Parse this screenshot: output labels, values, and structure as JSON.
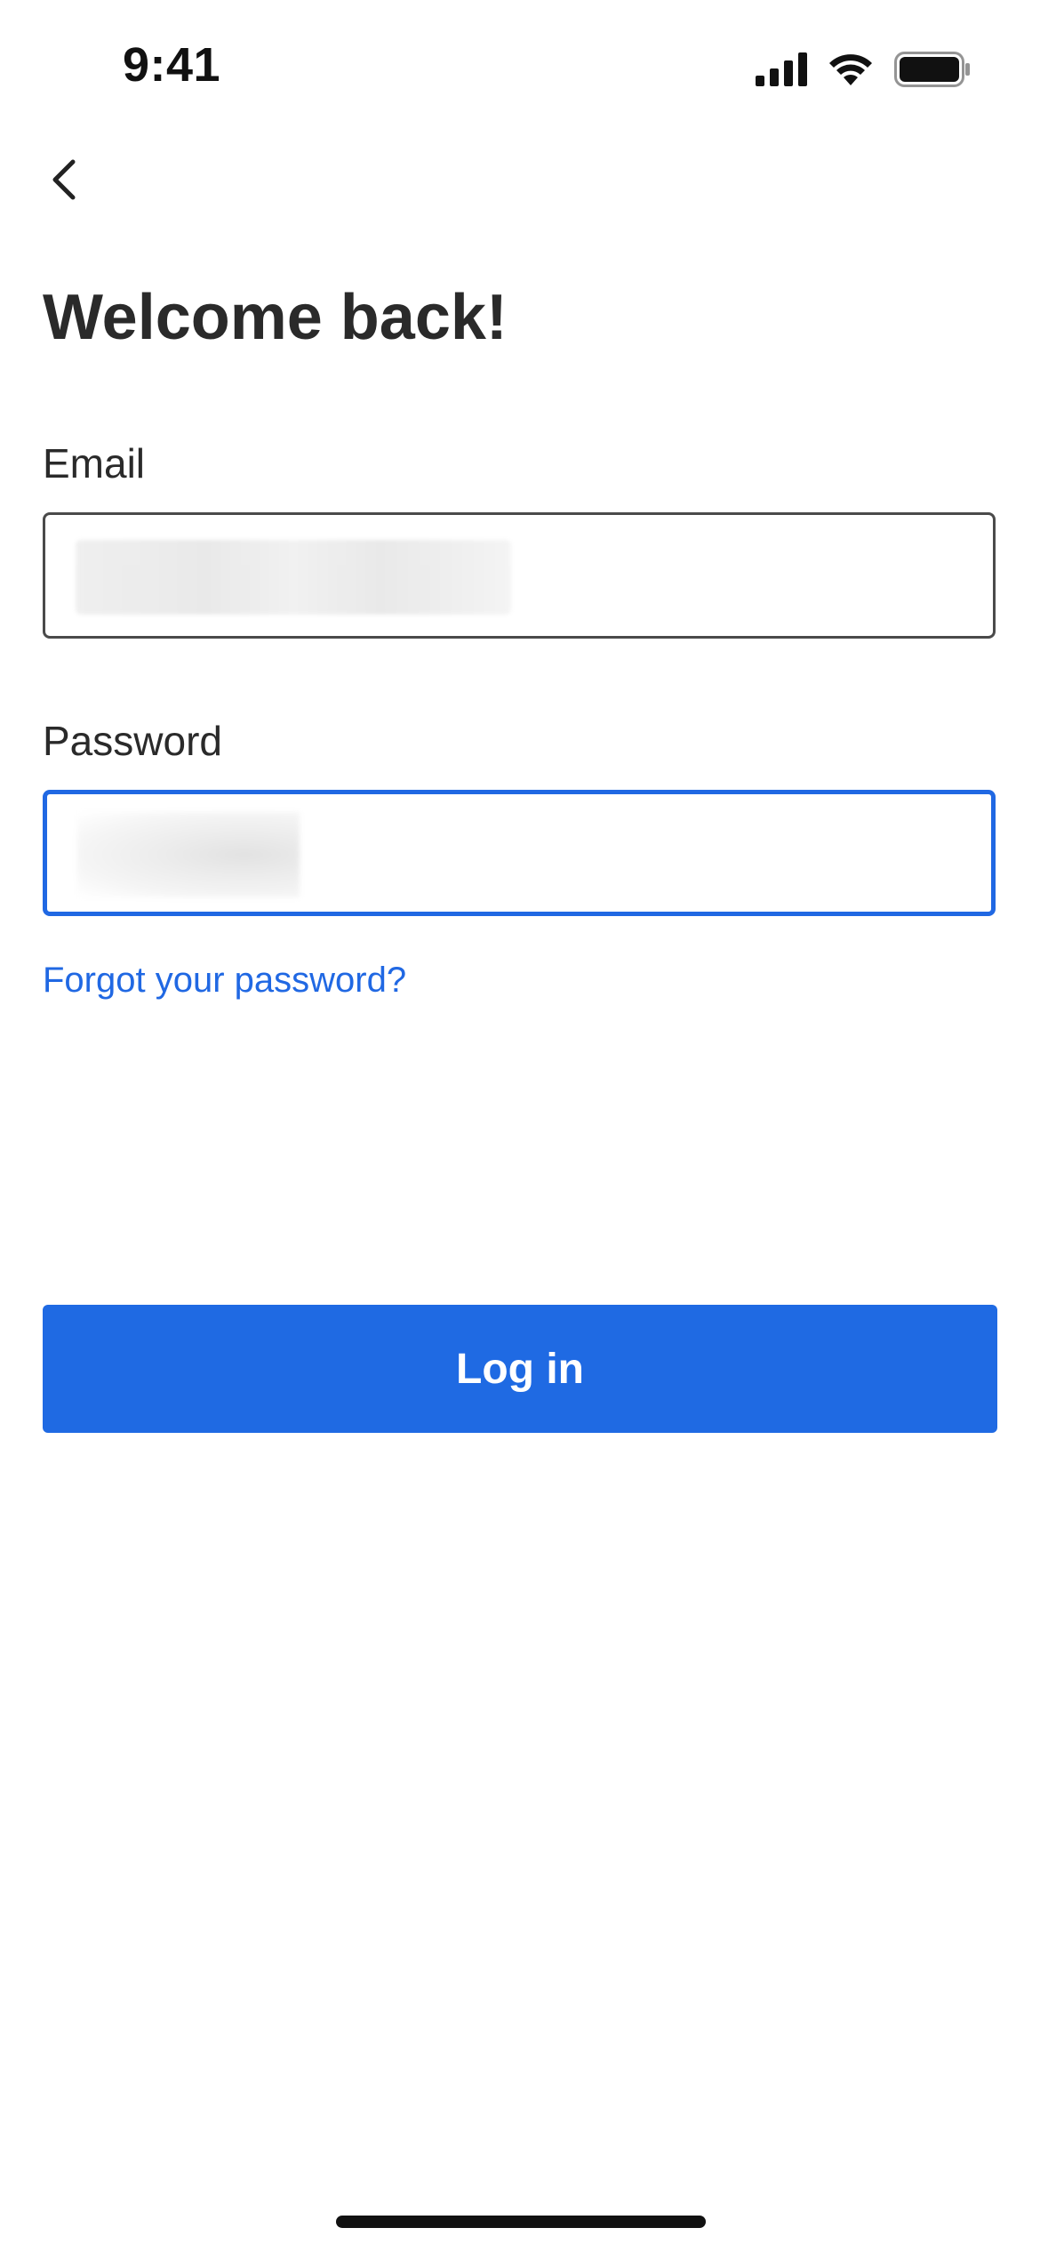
{
  "status_bar": {
    "time": "9:41",
    "icons": [
      "cellular-signal-icon",
      "wifi-icon",
      "battery-icon"
    ]
  },
  "nav": {
    "back_icon": "chevron-left-icon"
  },
  "header": {
    "title": "Welcome back!"
  },
  "form": {
    "email_label": "Email",
    "password_label": "Password",
    "forgot_link": "Forgot your password?",
    "submit_label": "Log in"
  },
  "colors": {
    "accent": "#1f6ae3",
    "text": "#2a2a2a",
    "input_border": "#4a4a4a"
  }
}
